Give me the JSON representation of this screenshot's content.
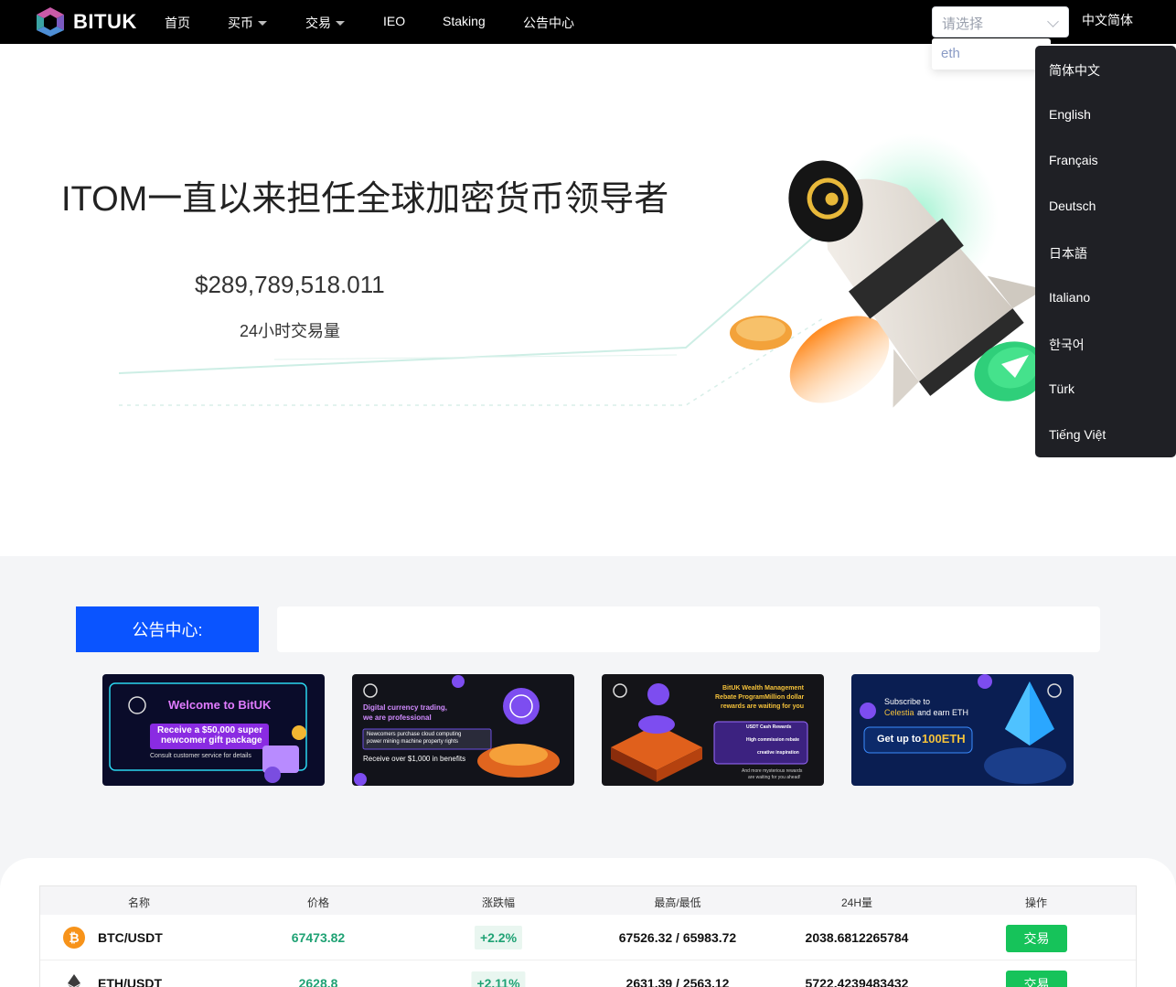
{
  "brand": {
    "name": "BITUK"
  },
  "nav": {
    "items": [
      {
        "label": "首页",
        "dropdown": false
      },
      {
        "label": "买币",
        "dropdown": true
      },
      {
        "label": "交易",
        "dropdown": true
      },
      {
        "label": "IEO",
        "dropdown": false
      },
      {
        "label": "Staking",
        "dropdown": false
      },
      {
        "label": "公告中心",
        "dropdown": false
      }
    ],
    "select": {
      "placeholder": "请选择",
      "option": "eth"
    },
    "language_current": "中文简体"
  },
  "language_menu": [
    "简体中文",
    "English",
    "Français",
    "Deutsch",
    "日本語",
    "Italiano",
    "한국어",
    "Türk",
    "Tiếng Việt"
  ],
  "hero": {
    "title": "ITOM一直以来担任全球加密货币领导者",
    "volume": "$289,789,518.011",
    "volume_label": "24小时交易量"
  },
  "notice": {
    "label": "公告中心:",
    "text": ""
  },
  "banners": [
    {
      "line1": "Welcome to BitUK",
      "line2": "Receive a $50,000 super",
      "line3": "newcomer gift package",
      "line4": "Consult customer service for details"
    },
    {
      "line1": "Digital currency trading,",
      "line2": "we are professional",
      "line3": "Newcomers purchase cloud computing",
      "line4": "power mining machine property rights",
      "line5": "Receive over $1,000 in benefits"
    },
    {
      "line1": "BitUK Wealth Management",
      "line2": "Rebate ProgramMillion dollar",
      "line3": "rewards are waiting for you",
      "chip1": "USDT Cash Rewards",
      "chip2": "High commission rebate",
      "chip3": "creative inspiration",
      "line4": "And more mysterious rewards",
      "line5": "are waiting for you ahead!"
    },
    {
      "line1": "Subscribe to",
      "line2a": "Celestia",
      "line2b": " and earn ETH",
      "line3a": "Get up to ",
      "line3b": "100ETH"
    }
  ],
  "market": {
    "headers": [
      "名称",
      "价格",
      "涨跌幅",
      "最高/最低",
      "24H量",
      "操作"
    ],
    "rows": [
      {
        "pair": "BTC/USDT",
        "icon": "bitcoin-icon",
        "price": "67473.82",
        "change": "+2.2%",
        "high_low": "67526.32 / 65983.72",
        "volume": "2038.6812265784",
        "action": "交易"
      },
      {
        "pair": "ETH/USDT",
        "icon": "ethereum-icon",
        "price": "2628.8",
        "change": "+2.11%",
        "high_low": "2631.39 / 2563.12",
        "volume": "5722.4239483432",
        "action": "交易"
      }
    ]
  },
  "colors": {
    "accent_blue": "#0a54ff",
    "up_green": "#1fa274",
    "trade_button": "#16c35a"
  }
}
